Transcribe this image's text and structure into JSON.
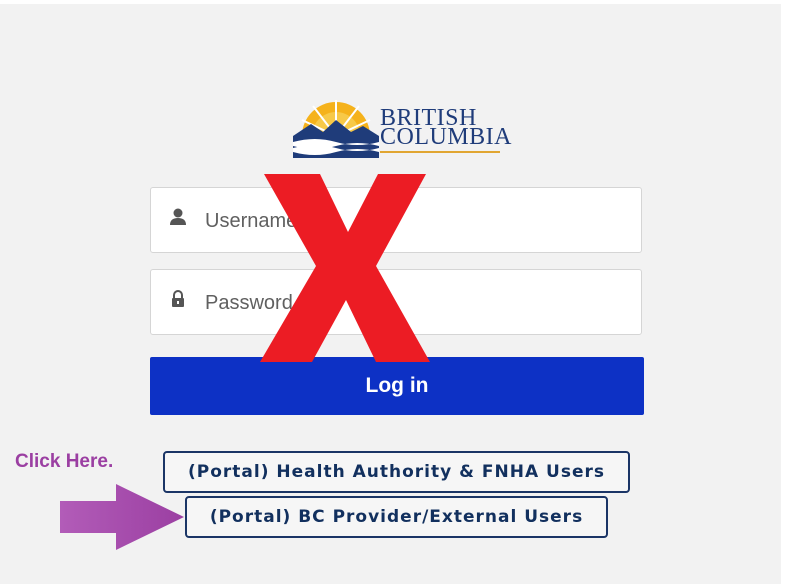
{
  "logo": {
    "line1": "BRITISH",
    "line2": "COLUMBIA",
    "colors": {
      "navy": "#1f3c7a",
      "gold": "#e1a632"
    }
  },
  "login_form": {
    "username_placeholder": "Username",
    "password_placeholder": "Password",
    "login_label": "Log in"
  },
  "portal_links": {
    "health_authority_label": "(Portal) Health Authority & FNHA Users",
    "bc_provider_label": "(Portal) BC Provider/External Users"
  },
  "annotations": {
    "click_here_text": "Click Here.",
    "overlay_mark": "x-mark",
    "arrow_color": "#a64bab",
    "x_color": "#ec1c24"
  },
  "icons": [
    "user-icon",
    "lock-icon",
    "right-arrow-icon",
    "x-mark-icon"
  ]
}
